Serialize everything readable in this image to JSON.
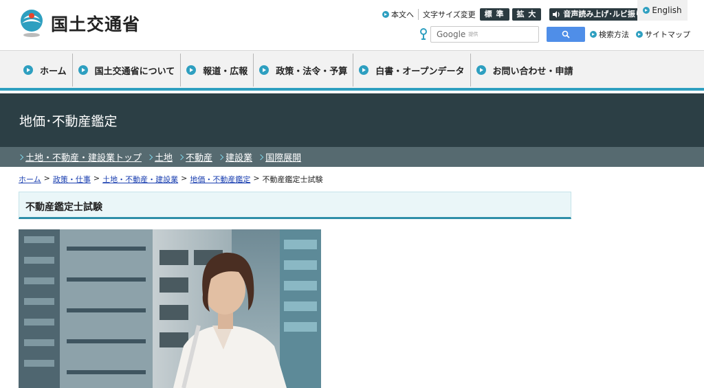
{
  "header": {
    "site_name": "国土交通省",
    "util": {
      "skip_to_content": "本文へ",
      "font_size_label": "文字サイズ変更",
      "font_standard": "標 準",
      "font_large": "拡 大",
      "voice_ruby": "音声読み上げ･ルビ振り",
      "english": "English"
    },
    "search": {
      "placeholder": "Google",
      "provided_by": "提供",
      "howto": "検索方法",
      "sitemap": "サイトマップ"
    }
  },
  "nav": {
    "items": [
      {
        "label": "ホーム"
      },
      {
        "label": "国土交通省について"
      },
      {
        "label": "報道・広報"
      },
      {
        "label": "政策・法令・予算"
      },
      {
        "label": "白書・オープンデータ"
      },
      {
        "label": "お問い合わせ・申請"
      }
    ]
  },
  "section": {
    "title": "地価･不動産鑑定",
    "subnav": [
      {
        "label": "土地・不動産・建設業トップ"
      },
      {
        "label": "土地"
      },
      {
        "label": "不動産"
      },
      {
        "label": "建設業"
      },
      {
        "label": "国際展開"
      }
    ]
  },
  "breadcrumb": {
    "items": [
      {
        "label": "ホーム"
      },
      {
        "label": "政策・仕事"
      },
      {
        "label": "土地・不動産・建設業"
      },
      {
        "label": "地価・不動産鑑定"
      }
    ],
    "separator": ">",
    "current": "不動産鑑定士試験"
  },
  "page": {
    "heading": "不動産鑑定士試験"
  },
  "colors": {
    "accent": "#2e9fc0",
    "band_dark": "#2c3f45",
    "subnav_bg": "#566a70",
    "search_button": "#4f8ee8"
  }
}
